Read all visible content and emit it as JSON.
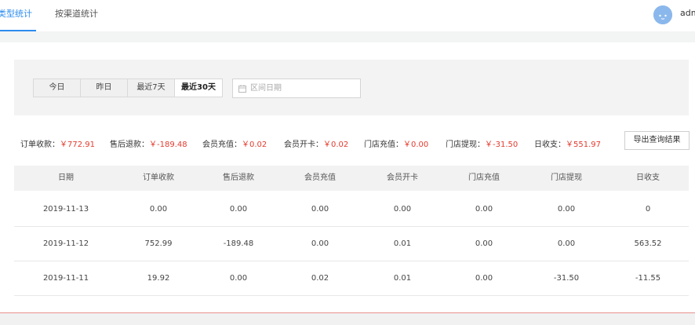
{
  "tabs": [
    {
      "label": "按类型统计",
      "active": true
    },
    {
      "label": "按渠道统计",
      "active": false
    }
  ],
  "user": {
    "name": "admin"
  },
  "quick_range": [
    "今日",
    "昨日",
    "最近7天",
    "最近30天"
  ],
  "date_range": {
    "placeholder": "区间日期",
    "value": ""
  },
  "summary": [
    {
      "label": "订单收款：",
      "value": "￥772.91"
    },
    {
      "label": "售后退款：",
      "value": "￥-189.48"
    },
    {
      "label": "会员充值：",
      "value": "￥0.02"
    },
    {
      "label": "会员开卡：",
      "value": "￥0.02"
    },
    {
      "label": "门店充值：",
      "value": "￥0.00"
    },
    {
      "label": "门店提现：",
      "value": "￥-31.50"
    },
    {
      "label": "日收支：",
      "value": "￥551.97"
    }
  ],
  "export_label": "导出查询结果",
  "table": {
    "headers": [
      "日期",
      "订单收款",
      "售后退款",
      "会员充值",
      "会员开卡",
      "门店充值",
      "门店提现",
      "日收支"
    ],
    "rows": [
      [
        "2019-11-13",
        "0.00",
        "0.00",
        "0.00",
        "0.00",
        "0.00",
        "0.00",
        "0"
      ],
      [
        "2019-11-12",
        "752.99",
        "-189.48",
        "0.00",
        "0.01",
        "0.00",
        "0.00",
        "563.52"
      ],
      [
        "2019-11-11",
        "19.92",
        "0.00",
        "0.02",
        "0.01",
        "0.00",
        "-31.50",
        "-11.55"
      ]
    ]
  },
  "colors": {
    "accent": "#2d8cf0",
    "amount_red": "#e33b2e"
  },
  "icons": {
    "date_input": "calendar-icon",
    "user": "avatar"
  }
}
